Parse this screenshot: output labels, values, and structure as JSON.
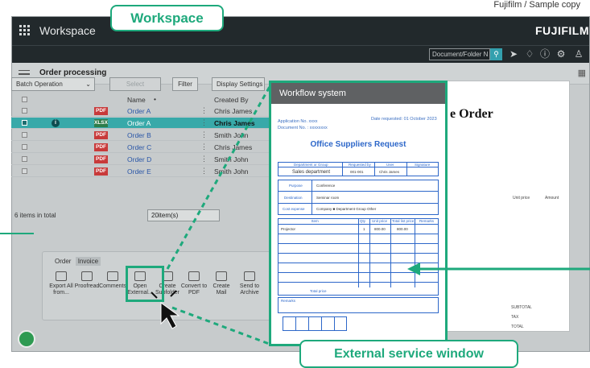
{
  "caption": "Fujifilm / Sample copy",
  "labels": {
    "workspace": "Workspace",
    "external": "External service window"
  },
  "app": {
    "title": "Workspace",
    "brand": "FUJIFILM",
    "search_placeholder": "Document/Folder N",
    "page_title": "Order processing"
  },
  "controls": {
    "batch": "Batch Operation",
    "select": "Select",
    "filter": "Filter",
    "display": "Display Settings"
  },
  "grid": {
    "col_name": "Name",
    "col_creator": "Created By",
    "rows": [
      {
        "type": "PDF",
        "name": "Order A",
        "creator": "Chris James",
        "selected": false
      },
      {
        "type": "XLSX",
        "name": "Order A",
        "creator": "Chris James",
        "selected": true
      },
      {
        "type": "PDF",
        "name": "Order B",
        "creator": "Smith John",
        "selected": false
      },
      {
        "type": "PDF",
        "name": "Order C",
        "creator": "Chris James",
        "selected": false
      },
      {
        "type": "PDF",
        "name": "Order D",
        "creator": "Smith John",
        "selected": false
      },
      {
        "type": "PDF",
        "name": "Order E",
        "creator": "Smith John",
        "selected": false
      }
    ],
    "info_mark": "i",
    "items_total": "6 items in total",
    "per_page": "20item(s)"
  },
  "actions": {
    "tabs": [
      "Order",
      "Invoice"
    ],
    "items": [
      {
        "label": "Export All from..."
      },
      {
        "label": "Proofread"
      },
      {
        "label": "Comments"
      },
      {
        "label": "Open External..."
      },
      {
        "label": "Create Subfolder"
      },
      {
        "label": "Convert to PDF"
      },
      {
        "label": "Create Mail"
      },
      {
        "label": "Send to Archive"
      }
    ]
  },
  "popup": {
    "title": "Workflow system",
    "app_no": "Application No. xxxx",
    "doc_no": "Document No. : xxxxxxxx",
    "date_requested": "Date requested: 01 October 2023",
    "request_title": "Office Suppliers Request",
    "header_row": [
      "Department or Group",
      "Requested by",
      "User",
      "Signature"
    ],
    "dept_row": [
      "Sales department",
      "001-001",
      "Chris James"
    ],
    "purpose_label": "Purpose",
    "purpose_value": "Conference",
    "destination_label": "Destination",
    "destination_value": "Seminar room",
    "cost_label": "Cost expense",
    "cost_value": "Company  ■ Department  Group  Other",
    "items_header": [
      "Item",
      "Qty",
      "Unit price",
      "Total list price",
      "Remarks"
    ],
    "item_row": [
      "Projector",
      "1",
      "800.00",
      "800.00"
    ],
    "total_label": "Total price",
    "remarks_label": "Remarks"
  },
  "right_doc": {
    "heading": "e Order",
    "subtotal": "SUBTOTAL",
    "tax": "TAX",
    "total": "TOTAL",
    "unit_price": "Unit price",
    "amount": "Amount"
  },
  "colors": {
    "accent": "#1ea97c",
    "selected_row": "#38a9a9",
    "pdf": "#c83a3a",
    "xlsx": "#2e7d4a"
  }
}
